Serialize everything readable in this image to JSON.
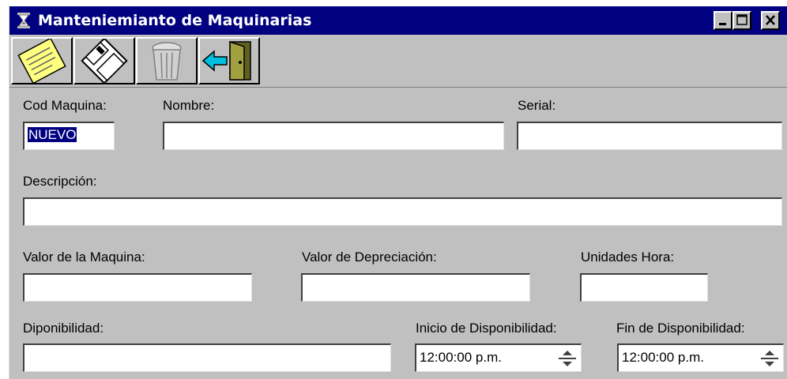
{
  "window": {
    "title": "Manteniemianto de Maquinarias"
  },
  "toolbar": {
    "items": [
      {
        "name": "new-note",
        "icon": "sticky-note-icon"
      },
      {
        "name": "save",
        "icon": "floppy-disk-icon"
      },
      {
        "name": "delete",
        "icon": "trash-can-icon"
      },
      {
        "name": "exit",
        "icon": "exit-door-icon"
      }
    ]
  },
  "form": {
    "cod_label": "Cod Maquina:",
    "cod_value": "NUEVO",
    "nombre_label": "Nombre:",
    "nombre_value": "",
    "serial_label": "Serial:",
    "serial_value": "",
    "descripcion_label": "Descripción:",
    "descripcion_value": "",
    "valor_label": "Valor de la Maquina:",
    "valor_value": "",
    "depreciacion_label": "Valor de Depreciación:",
    "depreciacion_value": "",
    "unidades_label": "Unidades Hora:",
    "unidades_value": "",
    "disponibilidad_label": "Diponibilidad:",
    "disponibilidad_value": "",
    "inicio_label": "Inicio de Disponibilidad:",
    "inicio_value": "12:00:00 p.m.",
    "fin_label": "Fin de Disponibilidad:",
    "fin_value": "12:00:00 p.m."
  },
  "colors": {
    "titlebar": "#000080",
    "face": "#c0c0c0",
    "selection": "#000080"
  }
}
